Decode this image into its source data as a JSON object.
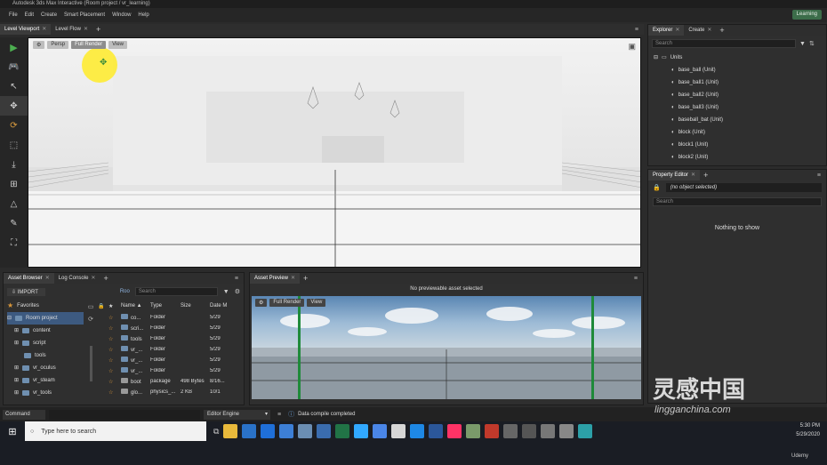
{
  "window": {
    "title": "Autodesk 3ds Max Interactive (Room project / vr_learning)"
  },
  "menu": {
    "items": [
      "File",
      "Edit",
      "Create",
      "Smart Placement",
      "Window",
      "Help"
    ],
    "learning_label": "Learning"
  },
  "viewport_tabs": {
    "level_viewport": "Level Viewport",
    "level_flow": "Level Flow"
  },
  "viewport_toolbar": {
    "persp": "Persp",
    "full_render": "Full Render",
    "view": "View"
  },
  "explorer": {
    "tabs": {
      "explorer": "Explorer",
      "create": "Create"
    },
    "search_placeholder": "Search",
    "root": "Units",
    "items": [
      "base_ball (Unit)",
      "base_ball1 (Unit)",
      "base_ball2 (Unit)",
      "base_ball3 (Unit)",
      "baseball_bat (Unit)",
      "block (Unit)",
      "block1 (Unit)",
      "block2 (Unit)"
    ]
  },
  "property_editor": {
    "tab": "Property Editor",
    "selection": "(no object selected)",
    "search_placeholder": "Search",
    "empty_message": "Nothing to show"
  },
  "asset_browser": {
    "tabs": {
      "asset_browser": "Asset Browser",
      "log_console": "Log Console"
    },
    "import_label": "IMPORT",
    "path_label": "Roo",
    "search_placeholder": "Search",
    "tree": {
      "favorites": "Favorites",
      "project": "Room project",
      "folders": [
        "content",
        "script",
        "tools",
        "vr_oculus",
        "vr_steam",
        "vr_tools"
      ]
    },
    "columns": [
      "Name ▲",
      "Type",
      "Size",
      "Date M"
    ],
    "rows": [
      {
        "name": "co...",
        "type": "Folder",
        "size": "",
        "date": "5/29"
      },
      {
        "name": "scri...",
        "type": "Folder",
        "size": "",
        "date": "5/29"
      },
      {
        "name": "tools",
        "type": "Folder",
        "size": "",
        "date": "5/29"
      },
      {
        "name": "vr_...",
        "type": "Folder",
        "size": "",
        "date": "5/29"
      },
      {
        "name": "vr_...",
        "type": "Folder",
        "size": "",
        "date": "5/29"
      },
      {
        "name": "vr_...",
        "type": "Folder",
        "size": "",
        "date": "5/29"
      },
      {
        "name": "boot",
        "type": "package",
        "size": "498 Bytes",
        "date": "8/16..."
      },
      {
        "name": "glo...",
        "type": "physics_...",
        "size": "2 KB",
        "date": "10/1"
      }
    ]
  },
  "asset_preview": {
    "tab": "Asset Preview",
    "message": "No previewable asset selected",
    "full_render": "Full Render",
    "view": "View"
  },
  "command_bar": {
    "command_label": "Command",
    "engine_select": "Editor Engine",
    "status": "Data compile completed"
  },
  "taskbar": {
    "search_placeholder": "Type here to search",
    "time": "5:30 PM",
    "date": "5/29/2020"
  },
  "watermark": {
    "brand": "灵感中国",
    "site": "lingganchina.com",
    "udemy": "Udemy"
  },
  "colors": {
    "accent_green": "#3c6d4a",
    "selection_blue": "#3d5a80",
    "star_orange": "#d8963a"
  }
}
